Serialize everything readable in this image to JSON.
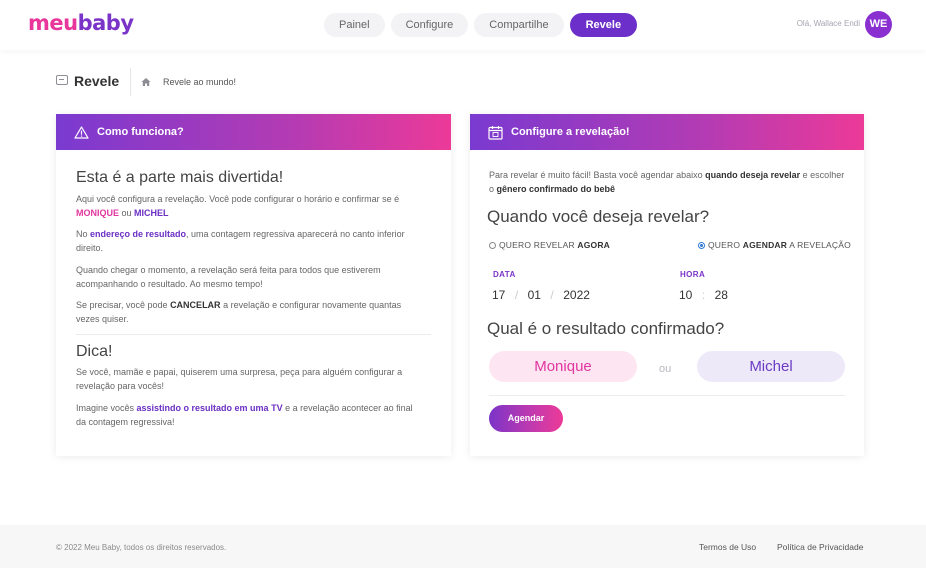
{
  "header": {
    "logo_part1": "meu",
    "logo_part2": "baby",
    "nav": [
      "Painel",
      "Configure",
      "Compartilhe",
      "Revele"
    ],
    "active_nav": "Revele",
    "greeting": "Olá, Wallace Endi",
    "avatar_initials": "WE"
  },
  "page": {
    "title": "Revele",
    "breadcrumb": "Revele ao mundo!"
  },
  "how_it_works": {
    "card_title": "Como funciona?",
    "heading": "Esta é a parte mais divertida!",
    "p1_a": "Aqui você configura a revelação. Você pode configurar o horário e confirmar se é",
    "p1_name1": "MONIQUE",
    "p1_or": " ou ",
    "p1_name2": "MICHEL",
    "p2_a": "No ",
    "p2_link": "endereço de resultado",
    "p2_b": ", uma contagem regressiva aparecerá no canto inferior direito.",
    "p3": "Quando chegar o momento, a revelação será feita para todos que estiverem acompanhando o resultado. Ao mesmo tempo!",
    "p4_a": "Se precisar, você pode ",
    "p4_strong": "CANCELAR",
    "p4_b": " a revelação e configurar novamente quantas vezes quiser.",
    "tip_heading": "Dica!",
    "tip_p1": "Se você, mamãe e papai, quiserem uma surpresa, peça para alguém configurar a revelação para vocês!",
    "tip_p2_a": "Imagine vocês ",
    "tip_p2_link": "assistindo o resultado em uma TV",
    "tip_p2_b": " e a revelação acontecer ao final da contagem regressiva!"
  },
  "configure": {
    "card_title": "Configure a revelação!",
    "intro_a": "Para revelar é muito fácil! Basta você agendar abaixo ",
    "intro_strong1": "quando deseja revelar",
    "intro_b": " e escolher o ",
    "intro_strong2": "gênero confirmado do bebê",
    "when_heading": "Quando você deseja revelar?",
    "option_now_a": "QUERO REVELAR ",
    "option_now_b": "AGORA",
    "option_schedule_a": "QUERO ",
    "option_schedule_b": "AGENDAR",
    "option_schedule_c": " A REVELAÇÃO",
    "selected_option": "schedule",
    "date_label": "DATA",
    "date_day": "17",
    "date_month": "01",
    "date_year": "2022",
    "time_label": "HORA",
    "time_hour": "10",
    "time_minute": "28",
    "result_heading": "Qual é o resultado confirmado?",
    "choice_a": "Monique",
    "or_label": "ou",
    "choice_b": "Michel",
    "submit_label": "Agendar"
  },
  "footer": {
    "copyright": "© 2022 Meu Baby, todos os direitos reservados.",
    "terms": "Termos de Uso",
    "privacy": "Política de Privacidade"
  },
  "colors": {
    "purple": "#6d2fc9",
    "pink": "#e8369a",
    "gradient_start": "#7a3ad0",
    "gradient_end": "#ec3a98"
  }
}
